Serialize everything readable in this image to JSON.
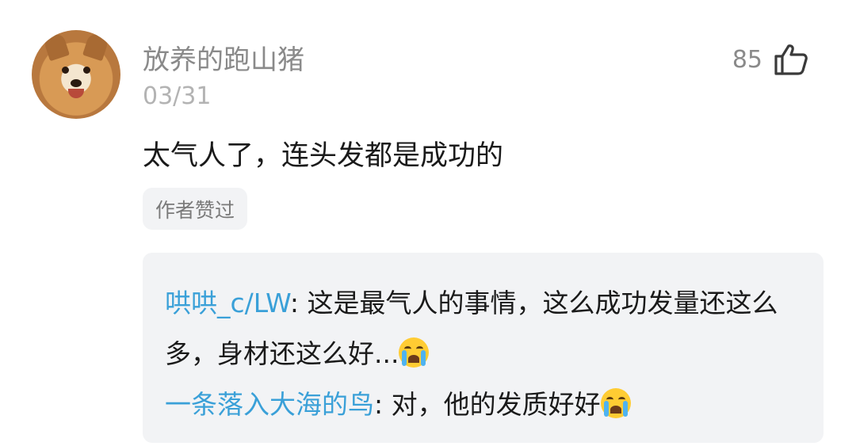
{
  "comment": {
    "username": "放养的跑山猪",
    "date": "03/31",
    "like_count": "85",
    "text": "太气人了，连头发都是成功的",
    "author_badge": "作者赞过"
  },
  "replies": [
    {
      "user": "哄哄_c/LW",
      "separator": ": ",
      "text": "这是最气人的事情，这么成功发量还这么多，身材还这么好...",
      "emoji": "loudly-crying-face-icon"
    },
    {
      "user": "一条落入大海的鸟",
      "separator": ": ",
      "text": "对，他的发质好好",
      "emoji": "loudly-crying-face-icon"
    }
  ],
  "colors": {
    "reply_user": "#3aa0d8",
    "reply_box": "#f2f3f5",
    "meta_text": "#8a8a8a"
  }
}
